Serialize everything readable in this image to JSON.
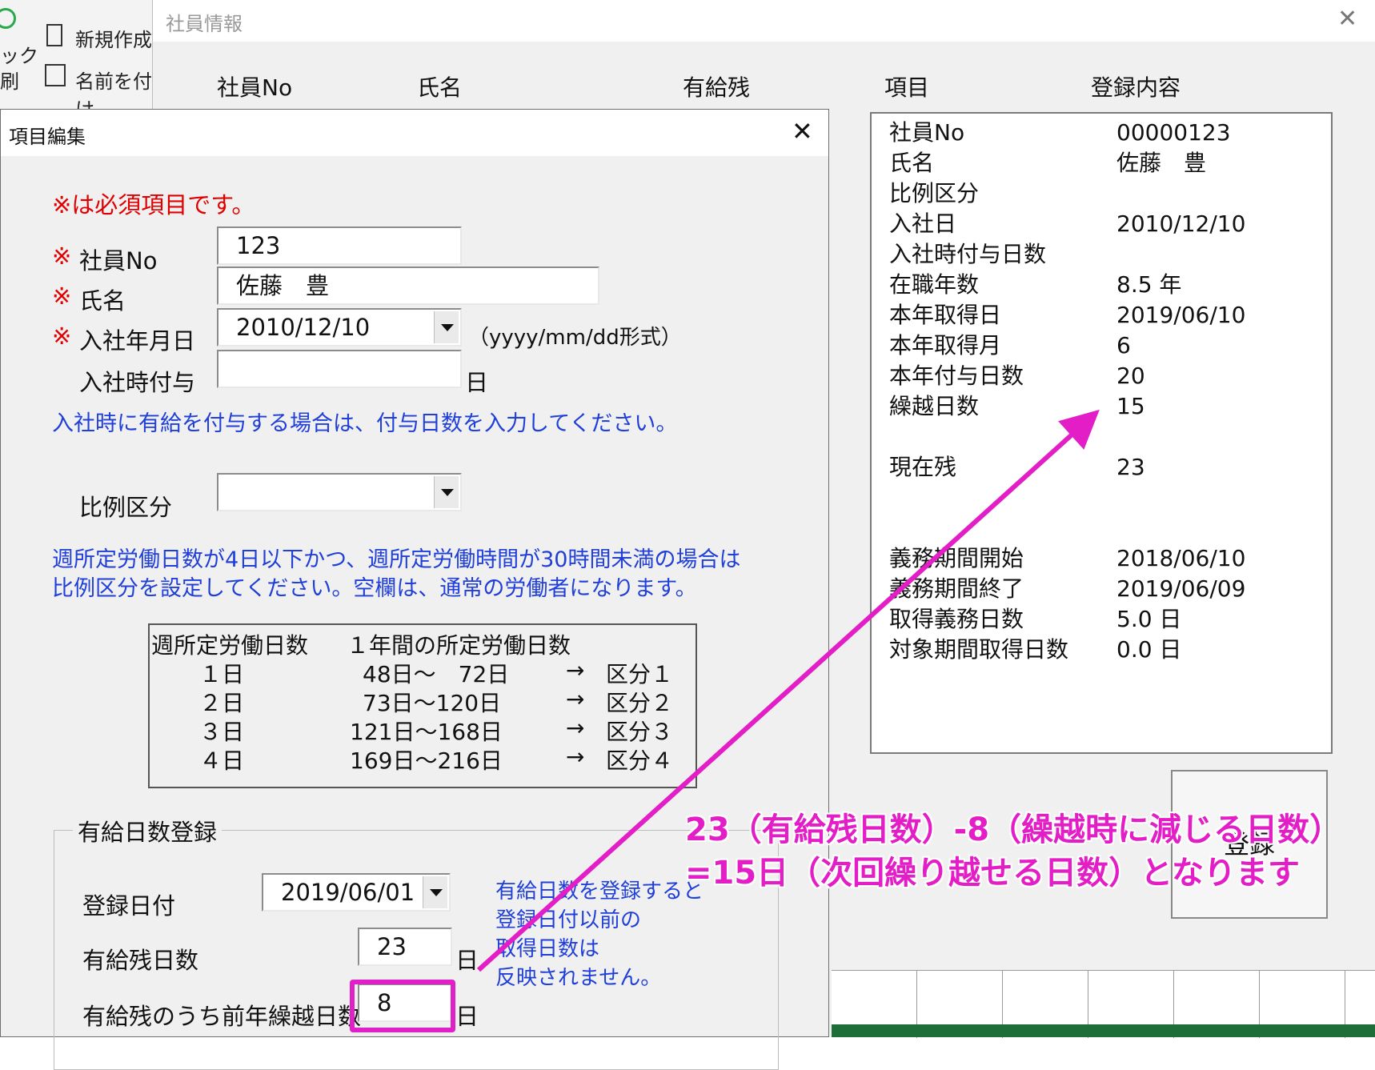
{
  "ribbon": {
    "items": [
      "新規作成",
      "名前を付け"
    ],
    "frag_a": "ック",
    "frag_b": "刷"
  },
  "back_window": {
    "title": "社員情報",
    "headers": [
      "社員No",
      "氏名",
      "有給残",
      "項目",
      "登録内容"
    ],
    "register_label": "登録",
    "rows": [
      {
        "label": "社員No",
        "value": "00000123"
      },
      {
        "label": "氏名",
        "value": "佐藤　豊"
      },
      {
        "label": "比例区分",
        "value": ""
      },
      {
        "label": "入社日",
        "value": "2010/12/10"
      },
      {
        "label": "入社時付与日数",
        "value": ""
      },
      {
        "label": "在職年数",
        "value": "8.5 年"
      },
      {
        "label": "本年取得日",
        "value": "2019/06/10"
      },
      {
        "label": "本年取得月",
        "value": "6"
      },
      {
        "label": "本年付与日数",
        "value": "20"
      },
      {
        "label": "繰越日数",
        "value": "15"
      },
      {
        "label": "現在残",
        "value": "23"
      },
      {
        "label": "義務期間開始",
        "value": "2018/06/10"
      },
      {
        "label": "義務期間終了",
        "value": "2019/06/09"
      },
      {
        "label": "取得義務日数",
        "value": "5.0 日"
      },
      {
        "label": "対象期間取得日数",
        "value": "0.0 日"
      }
    ]
  },
  "dialog": {
    "title": "項目編集",
    "required_note": "※は必須項目です。",
    "req_mark": "※",
    "emp_no_label": "社員No",
    "emp_no_value": "123",
    "name_label": "氏名",
    "name_value": "佐藤　豊",
    "hire_label": "入社年月日",
    "hire_value": "2010/12/10",
    "hire_format": "（yyyy/mm/dd形式）",
    "grant_label": "入社時付与",
    "grant_value": "",
    "day_unit": "日",
    "grant_note": "入社時に有給を付与する場合は、付与日数を入力してください。",
    "ratio_label": "比例区分",
    "ratio_value": "",
    "ratio_note_1": "週所定労働日数が4日以下かつ、週所定労働時間が30時間未満の場合は",
    "ratio_note_2": "比例区分を設定してください。空欄は、通常の労働者になります。",
    "table": {
      "header_1": "週所定労働日数",
      "header_2": "１年間の所定労働日数",
      "rows": [
        {
          "days": "１日",
          "range": "48日～　72日",
          "arrow": "→",
          "cat": "区分１"
        },
        {
          "days": "２日",
          "range": "73日～120日",
          "arrow": "→",
          "cat": "区分２"
        },
        {
          "days": "３日",
          "range": "121日～168日",
          "arrow": "→",
          "cat": "区分３"
        },
        {
          "days": "４日",
          "range": "169日～216日",
          "arrow": "→",
          "cat": "区分４"
        }
      ]
    },
    "paid": {
      "group_title": "有給日数登録",
      "reg_date_label": "登録日付",
      "reg_date_value": "2019/06/01",
      "remain_label": "有給残日数",
      "remain_value": "23",
      "carry_label": "有給残のうち前年繰越日数",
      "carry_value": "8",
      "note": [
        "有給日数を登録すると",
        "登録日付以前の",
        "取得日数は",
        "反映されません。"
      ]
    }
  },
  "annotation": {
    "line1": "23（有給残日数）-8（繰越時に減じる日数）",
    "line2": "=15日（次回繰り越せる日数）となります",
    "color": "#e31ec6"
  }
}
